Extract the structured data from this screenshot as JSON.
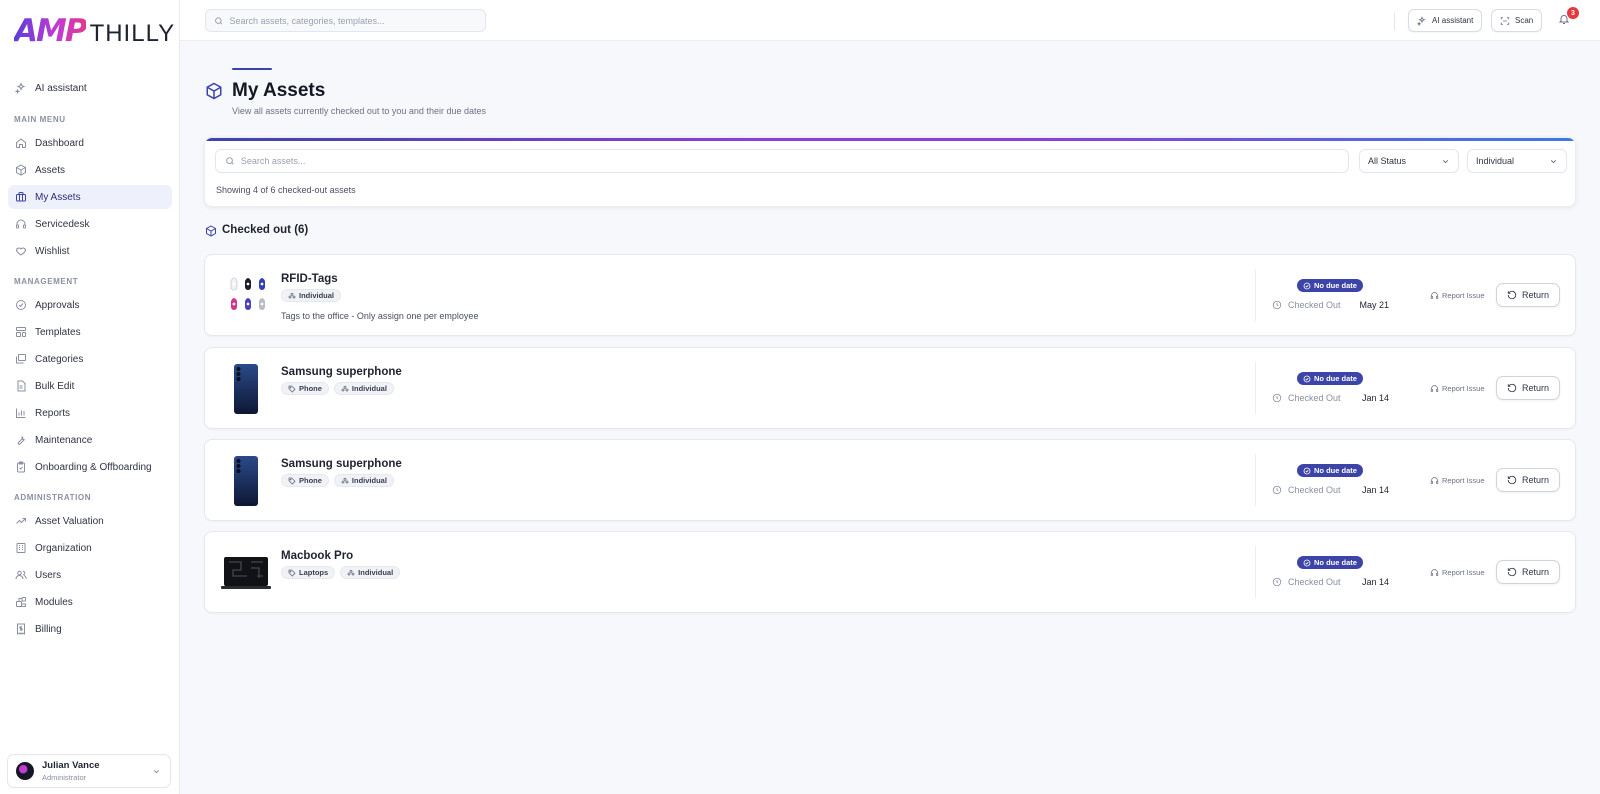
{
  "brand": {
    "mark": "AMP",
    "name": "THILLY"
  },
  "sidebar": {
    "ai_item": {
      "label": "AI assistant",
      "icon": "sparkles-icon"
    },
    "sections": [
      {
        "title": "MAIN MENU",
        "items": [
          {
            "label": "Dashboard",
            "icon": "home-icon"
          },
          {
            "label": "Assets",
            "icon": "box-icon"
          },
          {
            "label": "My Assets",
            "icon": "briefcase-icon",
            "active": true
          },
          {
            "label": "Servicedesk",
            "icon": "headset-icon"
          },
          {
            "label": "Wishlist",
            "icon": "heart-icon"
          }
        ]
      },
      {
        "title": "MANAGEMENT",
        "items": [
          {
            "label": "Approvals",
            "icon": "check-circle-icon"
          },
          {
            "label": "Templates",
            "icon": "layout-icon"
          },
          {
            "label": "Categories",
            "icon": "folders-icon"
          },
          {
            "label": "Bulk Edit",
            "icon": "file-icon"
          },
          {
            "label": "Reports",
            "icon": "bar-chart-icon"
          },
          {
            "label": "Maintenance",
            "icon": "wrench-icon"
          },
          {
            "label": "Onboarding & Offboarding",
            "icon": "clipboard-icon"
          }
        ]
      },
      {
        "title": "ADMINISTRATION",
        "items": [
          {
            "label": "Asset Valuation",
            "icon": "trending-up-icon"
          },
          {
            "label": "Organization",
            "icon": "building-icon"
          },
          {
            "label": "Users",
            "icon": "users-icon"
          },
          {
            "label": "Modules",
            "icon": "blocks-icon"
          },
          {
            "label": "Billing",
            "icon": "receipt-icon"
          }
        ]
      }
    ],
    "user": {
      "name": "Julian Vance",
      "role": "Administrator"
    }
  },
  "topbar": {
    "search_placeholder": "Search assets, categories, templates...",
    "ai_button": "AI assistant",
    "scan_button": "Scan",
    "notification_count": "3"
  },
  "page": {
    "title": "My Assets",
    "subtitle": "View all assets currently checked out to you and their due dates"
  },
  "filters": {
    "search_placeholder": "Search assets...",
    "status_select": "All Status",
    "type_select": "Individual",
    "count_text": "Showing 4 of 6 checked-out assets"
  },
  "section": {
    "title": "Checked out (6)"
  },
  "assets": [
    {
      "name": "RFID-Tags",
      "thumb": "rfid-tags",
      "tags": [
        {
          "label": "Individual",
          "icon": "users-icon"
        }
      ],
      "description": "Tags to the office - Only assign one per employee",
      "due": "No due date",
      "checked_out_label": "Checked Out",
      "date": "May 21",
      "report": "Report Issue",
      "return": "Return"
    },
    {
      "name": "Samsung superphone",
      "thumb": "phone",
      "tags": [
        {
          "label": "Phone",
          "icon": "tag-icon"
        },
        {
          "label": "Individual",
          "icon": "users-icon"
        }
      ],
      "description": "",
      "due": "No due date",
      "checked_out_label": "Checked Out",
      "date": "Jan 14",
      "report": "Report Issue",
      "return": "Return"
    },
    {
      "name": "Samsung superphone",
      "thumb": "phone",
      "tags": [
        {
          "label": "Phone",
          "icon": "tag-icon"
        },
        {
          "label": "Individual",
          "icon": "users-icon"
        }
      ],
      "description": "",
      "due": "No due date",
      "checked_out_label": "Checked Out",
      "date": "Jan 14",
      "report": "Report Issue",
      "return": "Return"
    },
    {
      "name": "Macbook Pro",
      "thumb": "laptop",
      "tags": [
        {
          "label": "Laptops",
          "icon": "tag-icon"
        },
        {
          "label": "Individual",
          "icon": "users-icon"
        }
      ],
      "description": "",
      "due": "No due date",
      "checked_out_label": "Checked Out",
      "date": "Jan 14",
      "report": "Report Issue",
      "return": "Return"
    }
  ],
  "colors": {
    "accent": "#3d44a8",
    "badge": "#e5393f"
  }
}
